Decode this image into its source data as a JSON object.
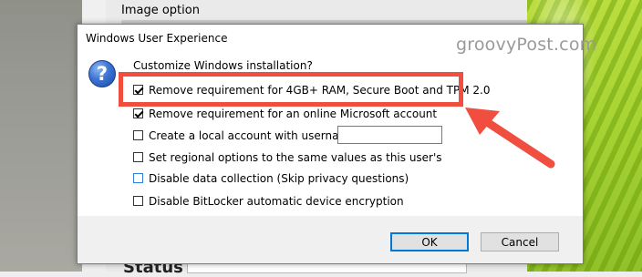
{
  "background": {
    "image_option_label": "Image option",
    "status_label": "Status"
  },
  "watermark": "groovyPost.com",
  "dialog": {
    "title": "Windows User Experience",
    "intro": "Customize Windows installation?",
    "options": [
      {
        "label": "Remove requirement for 4GB+ RAM, Secure Boot and TPM 2.0",
        "checked": true
      },
      {
        "label": "Remove requirement for an online Microsoft account",
        "checked": true
      },
      {
        "label": "Create a local account with username:",
        "checked": false
      },
      {
        "label": "Set regional options to the same values as this user's",
        "checked": false
      },
      {
        "label": "Disable data collection (Skip privacy questions)",
        "checked": false
      },
      {
        "label": "Disable BitLocker automatic device encryption",
        "checked": false
      }
    ],
    "username_value": "",
    "ok_label": "OK",
    "cancel_label": "Cancel",
    "icon": "question-icon"
  },
  "colors": {
    "annotation_red": "#f04e3e",
    "ok_focus_blue": "#0078d7"
  }
}
